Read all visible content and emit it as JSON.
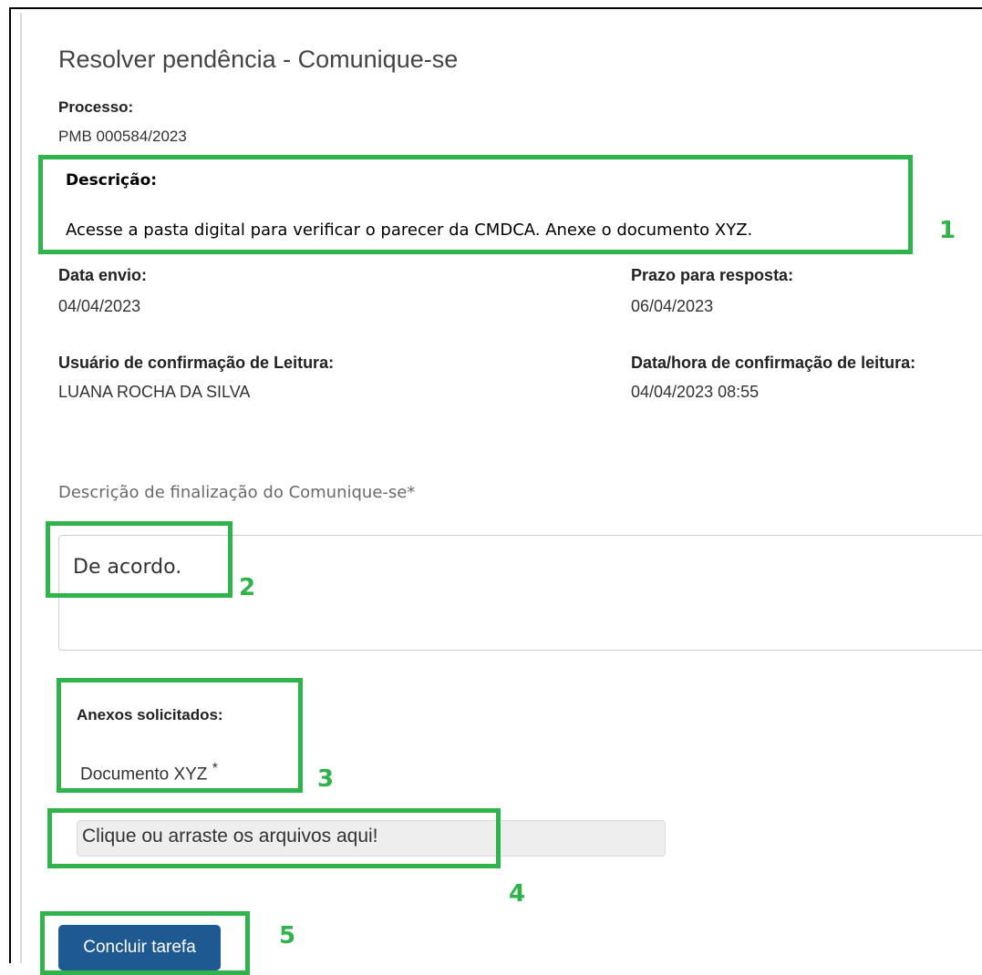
{
  "title": "Resolver pendência - Comunique-se",
  "processo": {
    "label": "Processo:",
    "value": "PMB 000584/2023"
  },
  "descricao": {
    "label": "Descrição:",
    "text": "Acesse a pasta digital para verificar o parecer da CMDCA. Anexe o documento XYZ."
  },
  "data_envio": {
    "label": "Data envio:",
    "value": "04/04/2023"
  },
  "prazo": {
    "label": "Prazo para resposta:",
    "value": "06/04/2023"
  },
  "usuario_leitura": {
    "label": "Usuário de confirmação de Leitura:",
    "value": "LUANA ROCHA DA SILVA"
  },
  "data_hora_leitura": {
    "label": "Data/hora de confirmação de leitura:",
    "value": "04/04/2023 08:55"
  },
  "finalizacao": {
    "label": "Descrição de finalização do Comunique-se*",
    "value": "De acordo."
  },
  "anexos": {
    "label": "Anexos solicitados:",
    "item": "Documento XYZ",
    "required_mark": "*"
  },
  "dropzone": {
    "text": "Clique ou arraste os arquivos aqui!"
  },
  "button": {
    "label": "Concluir tarefa"
  },
  "annotations": [
    "1",
    "2",
    "3",
    "4",
    "5"
  ],
  "colors": {
    "annotation_green": "#2fb34a",
    "button_blue": "#1e5a91"
  }
}
